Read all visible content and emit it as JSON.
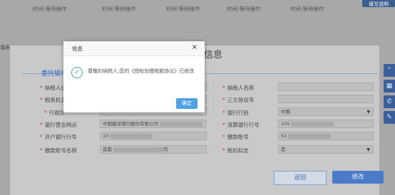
{
  "status_row": {
    "items": [
      "时间:等待操作",
      "时间:等待操作",
      "时间:等待操作",
      "时间:等待操作",
      "时间:等待操作"
    ],
    "fill_button": "填写说明"
  },
  "side_label": "填表",
  "page_heading": "信息",
  "section_title": "委托银行",
  "form": {
    "left": [
      {
        "label": "纳税人识",
        "required": true,
        "value": ""
      },
      {
        "label": "税务机关",
        "required": true,
        "value": ""
      },
      {
        "label": "行政区",
        "required": true,
        "value": ""
      },
      {
        "label": "银行营业网点",
        "required": true,
        "value": "中国建设银行股份有限公司"
      },
      {
        "label": "开户银行行号",
        "required": true,
        "value": "10"
      },
      {
        "label": "缴款账号名称",
        "required": true,
        "value": "成都",
        "suffix": "司"
      }
    ],
    "right": [
      {
        "label": "纳税人名称",
        "required": true,
        "value": ""
      },
      {
        "label": "三方协议号",
        "required": true,
        "value": ""
      },
      {
        "label": "银行行别",
        "required": true,
        "value": "中国",
        "select": true
      },
      {
        "label": "清算银行行号",
        "required": true,
        "value": "105"
      },
      {
        "label": "缴款账号",
        "required": true,
        "value": "51"
      },
      {
        "label": "批扣标志",
        "required": true,
        "value": "是",
        "select": true
      }
    ]
  },
  "buttons": {
    "return": "返回",
    "modify": "修改"
  },
  "side_tools": [
    "chevron-up-icon",
    "qr-icon",
    "phone-icon",
    "edit-icon"
  ],
  "modal": {
    "title": "信息",
    "close": "×",
    "message": "尊敬的纳税人,您的《授权划缴税款协议》已修改",
    "ok": "确定",
    "icon_color": "#3fb28a"
  }
}
